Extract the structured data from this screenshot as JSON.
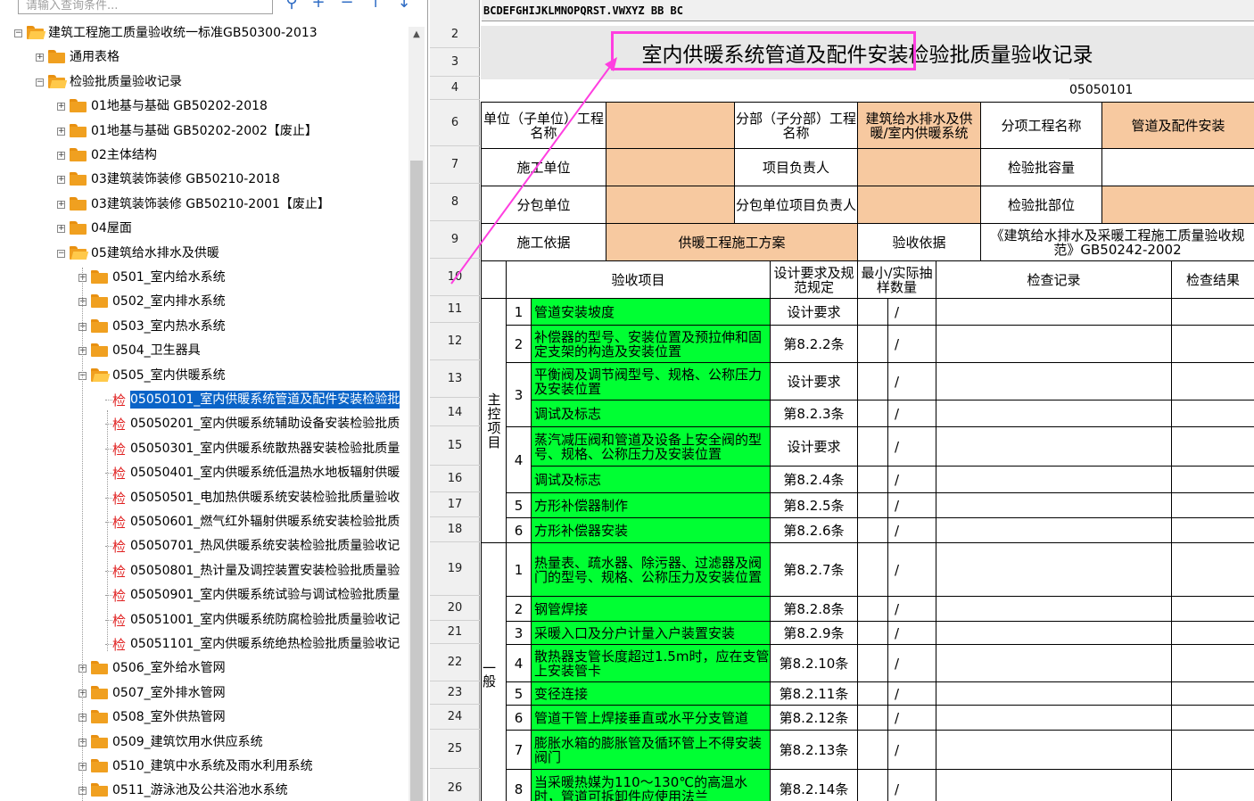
{
  "search": {
    "placeholder": "请输入查询条件..."
  },
  "toolbar_icons": [
    "search-icon",
    "plus-icon",
    "minus-icon",
    "move-up-icon",
    "move-down-icon"
  ],
  "tree": [
    {
      "label": "建筑工程施工质量验收统一标准GB50300-2013",
      "level": 0,
      "expanded": true
    },
    {
      "label": "通用表格",
      "level": 1,
      "expanded": false
    },
    {
      "label": "检验批质量验收记录",
      "level": 1,
      "expanded": true
    },
    {
      "label": "01地基与基础 GB50202-2018",
      "level": 2,
      "expanded": false
    },
    {
      "label": "01地基与基础 GB50202-2002【废止】",
      "level": 2,
      "expanded": false
    },
    {
      "label": "02主体结构",
      "level": 2,
      "expanded": false
    },
    {
      "label": "03建筑装饰装修 GB50210-2018",
      "level": 2,
      "expanded": false
    },
    {
      "label": "03建筑装饰装修 GB50210-2001【废止】",
      "level": 2,
      "expanded": false
    },
    {
      "label": "04屋面",
      "level": 2,
      "expanded": false
    },
    {
      "label": "05建筑给水排水及供暖",
      "level": 2,
      "expanded": true
    },
    {
      "label": "0501_室内给水系统",
      "level": 3,
      "expanded": false
    },
    {
      "label": "0502_室内排水系统",
      "level": 3,
      "expanded": false
    },
    {
      "label": "0503_室内热水系统",
      "level": 3,
      "expanded": false
    },
    {
      "label": "0504_卫生器具",
      "level": 3,
      "expanded": false
    },
    {
      "label": "0505_室内供暖系统",
      "level": 3,
      "expanded": true
    },
    {
      "label": "05050101_室内供暖系统管道及配件安装检验批",
      "level": 4,
      "leaf": true,
      "selected": true
    },
    {
      "label": "05050201_室内供暖系统辅助设备安装检验批质",
      "level": 4,
      "leaf": true
    },
    {
      "label": "05050301_室内供暖系统散热器安装检验批质量",
      "level": 4,
      "leaf": true
    },
    {
      "label": "05050401_室内供暖系统低温热水地板辐射供暖",
      "level": 4,
      "leaf": true
    },
    {
      "label": "05050501_电加热供暖系统安装检验批质量验收",
      "level": 4,
      "leaf": true
    },
    {
      "label": "05050601_燃气红外辐射供暖系统安装检验批质",
      "level": 4,
      "leaf": true
    },
    {
      "label": "05050701_热风供暖系统安装检验批质量验收记",
      "level": 4,
      "leaf": true
    },
    {
      "label": "05050801_热计量及调控装置安装检验批质量验",
      "level": 4,
      "leaf": true
    },
    {
      "label": "05050901_室内供暖系统试验与调试检验批质量",
      "level": 4,
      "leaf": true
    },
    {
      "label": "05051001_室内供暖系统防腐检验批质量验收记",
      "level": 4,
      "leaf": true
    },
    {
      "label": "05051101_室内供暖系统绝热检验批质量验收记",
      "level": 4,
      "leaf": true
    },
    {
      "label": "0506_室外给水管网",
      "level": 3,
      "expanded": false
    },
    {
      "label": "0507_室外排水管网",
      "level": 3,
      "expanded": false
    },
    {
      "label": "0508_室外供热管网",
      "level": 3,
      "expanded": false
    },
    {
      "label": "0509_建筑饮用水供应系统",
      "level": 3,
      "expanded": false
    },
    {
      "label": "0510_建筑中水系统及雨水利用系统",
      "level": 3,
      "expanded": false
    },
    {
      "label": "0511_游泳池及公共浴池水系统",
      "level": 3,
      "expanded": false
    }
  ],
  "leaf_tag": "检",
  "column_header": "BCDEFGHIJKLMNOPQRST.VWXYZ BB BC",
  "row_numbers": [
    "2",
    "3",
    "4",
    "6",
    "7",
    "8",
    "9",
    "10",
    "11",
    "12",
    "13",
    "14",
    "15",
    "16",
    "17",
    "18",
    "19",
    "20",
    "21",
    "22",
    "23",
    "24",
    "25",
    "26"
  ],
  "form": {
    "title": "室内供暖系统管道及配件安装检验批质量验收记录",
    "code": "05050101",
    "unit_label": "单位（子单位）工程名称",
    "part_label": "分部（子分部）工程名称",
    "part_value": "建筑给水排水及供暖/室内供暖系统",
    "subitem_label": "分项工程名称",
    "subitem_value": "管道及配件安装",
    "builder_label": "施工单位",
    "pm_label": "项目负责人",
    "capacity_label": "检验批容量",
    "sub_label": "分包单位",
    "sub_pm_label": "分包单位项目负责人",
    "location_label": "检验批部位",
    "basis_label": "施工依据",
    "basis_value": "供暖工程施工方案",
    "accept_basis_label": "验收依据",
    "accept_basis_value": "《建筑给水排水及采暖工程施工质量验收规范》GB50242-2002",
    "hdr_item": "验收项目",
    "hdr_req": "设计要求及规范规定",
    "hdr_sample": "最小/实际抽样数量",
    "hdr_record": "检查记录",
    "hdr_result": "检查结果",
    "main_label": "主控项目",
    "general_label": "一般",
    "slash": "/",
    "main_items": [
      {
        "no": "1",
        "text": "管道安装坡度",
        "req": "设计要求"
      },
      {
        "no": "2",
        "text": "补偿器的型号、安装位置及预拉伸和固定支架的构造及安装位置",
        "req": "第8.2.2条"
      },
      {
        "no": "3",
        "text": "平衡阀及调节阀型号、规格、公称压力及安装位置",
        "req": "设计要求"
      },
      {
        "no": "",
        "text": "调试及标志",
        "req": "第8.2.3条"
      },
      {
        "no": "4",
        "text": "蒸汽减压阀和管道及设备上安全阀的型号、规格、公称压力及安装位置",
        "req": "设计要求"
      },
      {
        "no": "",
        "text": "调试及标志",
        "req": "第8.2.4条"
      },
      {
        "no": "5",
        "text": "方形补偿器制作",
        "req": "第8.2.5条"
      },
      {
        "no": "6",
        "text": "方形补偿器安装",
        "req": "第8.2.6条"
      }
    ],
    "gen_items": [
      {
        "no": "1",
        "text": "热量表、疏水器、除污器、过滤器及阀门的型号、规格、公称压力及安装位置",
        "req": "第8.2.7条"
      },
      {
        "no": "2",
        "text": "钢管焊接",
        "req": "第8.2.8条"
      },
      {
        "no": "3",
        "text": "采暖入口及分户计量入户装置安装",
        "req": "第8.2.9条"
      },
      {
        "no": "4",
        "text": "散热器支管长度超过1.5m时，应在支管上安装管卡",
        "req": "第8.2.10条"
      },
      {
        "no": "5",
        "text": "变径连接",
        "req": "第8.2.11条"
      },
      {
        "no": "6",
        "text": "管道干管上焊接垂直或水平分支管道",
        "req": "第8.2.12条"
      },
      {
        "no": "7",
        "text": "膨胀水箱的膨胀管及循环管上不得安装阀门",
        "req": "第8.2.13条"
      },
      {
        "no": "8",
        "text": "当采暖热媒为110～130℃的高温水时，管道可拆卸件应使用法兰",
        "req": "第8.2.14条"
      }
    ]
  },
  "colors": {
    "highlight": "#ff3ee0",
    "green": "#00ff33",
    "tan": "#f7c9a0",
    "selection": "#0a64c8"
  }
}
